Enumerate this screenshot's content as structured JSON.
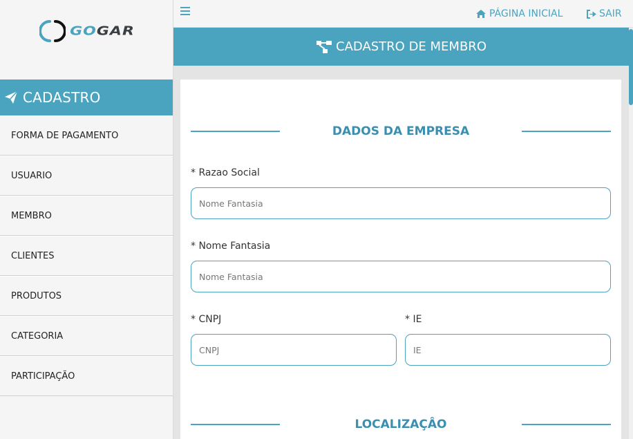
{
  "brand": {
    "logo_text_accent": "GO",
    "logo_text_rest": "GAR"
  },
  "colors": {
    "accent": "#4aa3bf",
    "sidebar_bg": "#f5f5f5",
    "content_bg": "#e4e4e4"
  },
  "sidebar": {
    "header": {
      "label": "CADASTRO",
      "icon": "paper-plane-icon"
    },
    "items": [
      {
        "label": "FORMA DE PAGAMENTO"
      },
      {
        "label": "USUARIO"
      },
      {
        "label": "MEMBRO"
      },
      {
        "label": "CLIENTES"
      },
      {
        "label": "PRODUTOS"
      },
      {
        "label": "CATEGORIA"
      },
      {
        "label": "PARTICIPAÇÃO"
      }
    ]
  },
  "topbar": {
    "menu_icon": "hamburger-icon",
    "home": {
      "label": "PÁGINA INICIAL",
      "icon": "home-icon"
    },
    "exit": {
      "label": "SAIR",
      "icon": "sign-out-icon"
    }
  },
  "page": {
    "title": "CADASTRO DE MEMBRO",
    "icon": "sitemap-icon"
  },
  "form": {
    "section_company": "DADOS DA EMPRESA",
    "razao_social": {
      "label": "* Razao Social",
      "placeholder": "Nome Fantasia",
      "value": ""
    },
    "nome_fantasia": {
      "label": "* Nome Fantasia",
      "placeholder": "Nome Fantasia",
      "value": ""
    },
    "cnpj": {
      "label": "* CNPJ",
      "placeholder": "CNPJ",
      "value": ""
    },
    "ie": {
      "label": "* IE",
      "placeholder": "IE",
      "value": ""
    },
    "section_location": "LOCALIZAÇÂO"
  }
}
